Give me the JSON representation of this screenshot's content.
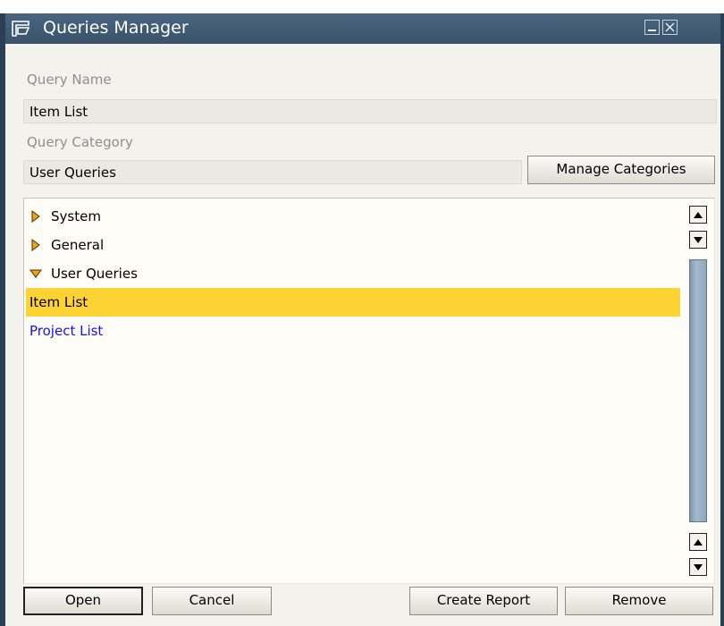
{
  "window": {
    "title": "Queries Manager"
  },
  "form": {
    "query_name_label": "Query Name",
    "query_name_value": "Item List",
    "query_category_label": "Query Category",
    "query_category_value": "User Queries",
    "manage_categories_label": "Manage Categories"
  },
  "tree": {
    "items": [
      {
        "label": "System",
        "state": "collapsed"
      },
      {
        "label": "General",
        "state": "collapsed"
      },
      {
        "label": "User Queries",
        "state": "expanded"
      },
      {
        "label": "Item List",
        "state": "selected"
      },
      {
        "label": "Project List",
        "state": "normal"
      }
    ]
  },
  "footer": {
    "open_label": "Open",
    "cancel_label": "Cancel",
    "create_report_label": "Create Report",
    "remove_label": "Remove"
  },
  "colors": {
    "titlebar": "#3f5872",
    "selection": "#fdd233",
    "link": "#1a10e8",
    "arrow": "#f0a01a"
  },
  "icons": {
    "title": "queries-window-icon",
    "collapsed": "triangle-right-icon",
    "expanded": "triangle-down-icon"
  }
}
